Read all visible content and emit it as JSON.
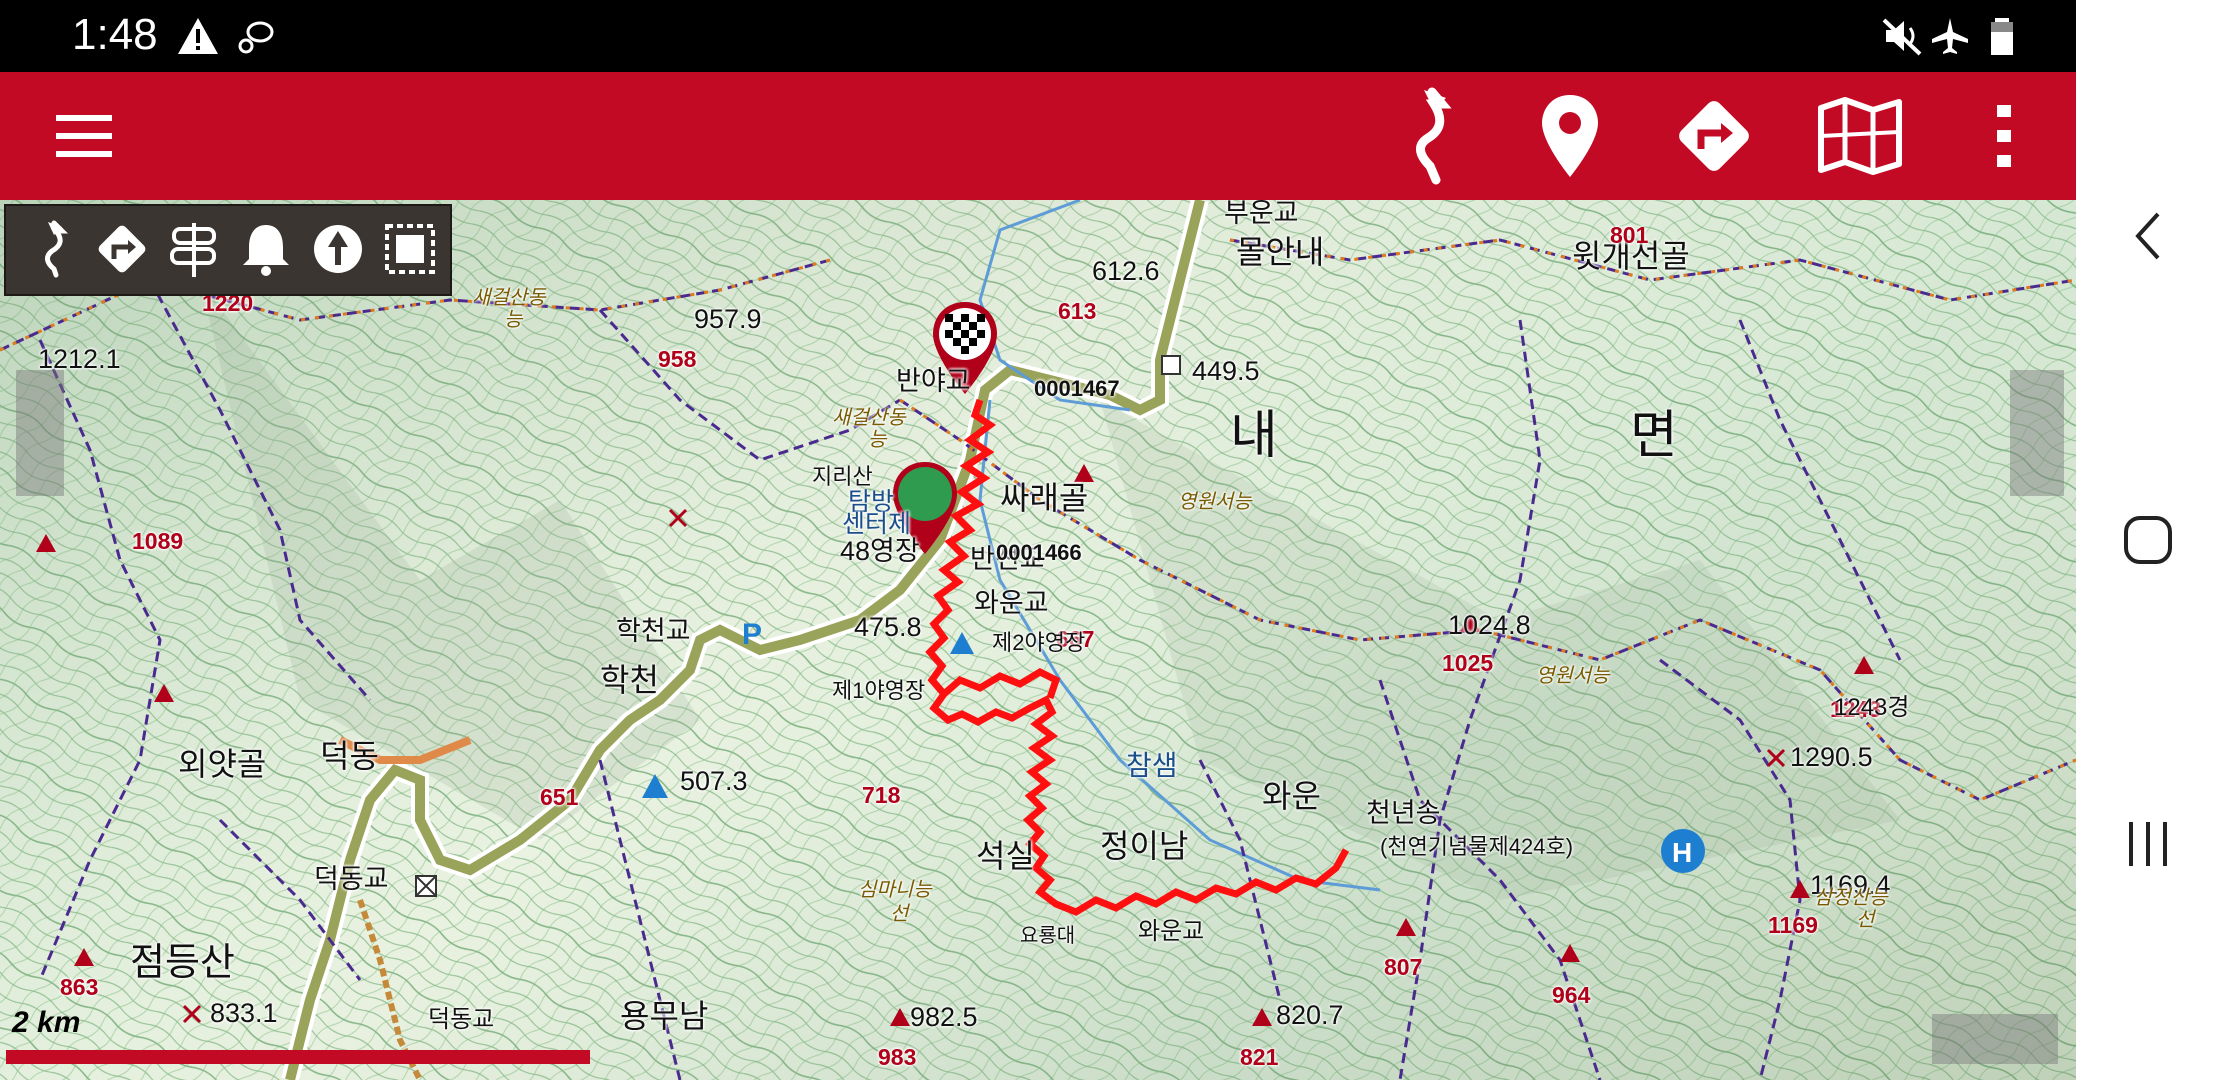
{
  "status_bar": {
    "time": "1:48",
    "left_icons": [
      "warning-icon",
      "shoe-icon"
    ],
    "right_icons": [
      "mute-icon",
      "airplane-icon",
      "battery-icon"
    ]
  },
  "toolbar": {
    "menu_icon": "hamburger-menu-icon",
    "actions": [
      "route-icon",
      "waypoint-icon",
      "directions-icon",
      "map-icon",
      "overflow-menu-icon"
    ]
  },
  "tool_strip": {
    "tools": [
      "track-icon",
      "navigate-icon",
      "signpost-icon",
      "alarm-icon",
      "north-arrow-icon",
      "selection-icon"
    ]
  },
  "map": {
    "big_labels": [
      "내",
      "면"
    ],
    "mid_labels": [
      "점등산",
      "학천",
      "덕동",
      "외얏골",
      "석실",
      "정이남",
      "와운",
      "싸래골",
      "몰안내",
      "윗개선골",
      "용무남"
    ],
    "elevations": [
      "1212.1",
      "957.9",
      "612.6",
      "449.5",
      "475.8",
      "507.3",
      "1024.8",
      "1290.5",
      "1169.4",
      "833.1",
      "982.5",
      "820.7"
    ],
    "peak_labels": [
      "1220",
      "958",
      "613",
      "1089",
      "651",
      "718",
      "667",
      "1025",
      "1243",
      "863",
      "807",
      "964",
      "983",
      "821",
      "1169",
      "801"
    ],
    "place_labels": [
      "반야교",
      "반선교",
      "와운교",
      "학천교",
      "덕동교",
      "부운교",
      "천년송",
      "(천연기념물제424호)",
      "제2야영장",
      "제1야영장",
      "와운교",
      "요룡대",
      "덕동교",
      "48영장",
      "지리산",
      "탐방",
      "센터제"
    ],
    "codes": [
      "0001467",
      "0001466"
    ],
    "trail_labels": [
      "새걸산동",
      "능",
      "새걸산동",
      "능",
      "영원서능",
      "영원서능",
      "심마니능",
      "선",
      "삼정산능",
      "선"
    ],
    "other": [
      "참샘",
      "1243경"
    ]
  },
  "scale": {
    "label": "2 km"
  },
  "nav": {
    "icons": [
      "back-icon",
      "home-icon",
      "recents-icon"
    ]
  },
  "colors": {
    "toolbar": "#c30a25",
    "route": "#ff1010",
    "start_marker": "#2e9b4e",
    "contour": "#2e8a43",
    "trail": "#4b2a8f"
  }
}
